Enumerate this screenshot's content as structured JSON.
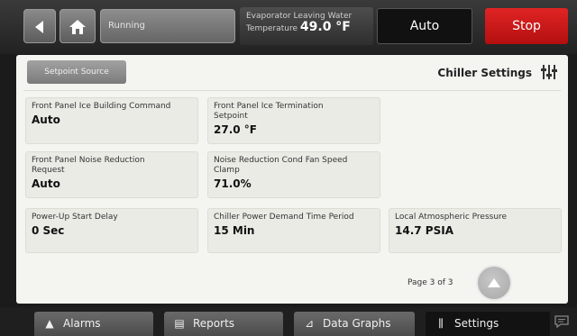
{
  "header": {
    "status": "Running",
    "evap_label_line1": "Evaporator Leaving Water",
    "evap_label_line2": "Temperature",
    "evap_value": "49.0 °F",
    "auto_label": "Auto",
    "stop_label": "Stop",
    "stop_color": "#d71a1a"
  },
  "panel": {
    "setpoint_source_label": "Setpoint Source",
    "title": "Chiller Settings",
    "cards": [
      {
        "label": "Front Panel Ice Building Command",
        "value": "Auto"
      },
      {
        "label": "Front Panel Ice Termination Setpoint",
        "value": "27.0 °F"
      },
      {
        "label": "Front Panel Noise Reduction Request",
        "value": "Auto"
      },
      {
        "label": "Noise Reduction Cond Fan Speed Clamp",
        "value": "71.0%"
      },
      {
        "label": "Power-Up Start Delay",
        "value": "0 Sec"
      },
      {
        "label": "Chiller Power Demand Time Period",
        "value": "15 Min"
      },
      {
        "label": "Local Atmospheric Pressure",
        "value": "14.7 PSIA"
      }
    ],
    "page_label": "Page 3 of 3"
  },
  "nav": {
    "alarms": "Alarms",
    "reports": "Reports",
    "data_graphs": "Data Graphs",
    "settings": "Settings"
  }
}
